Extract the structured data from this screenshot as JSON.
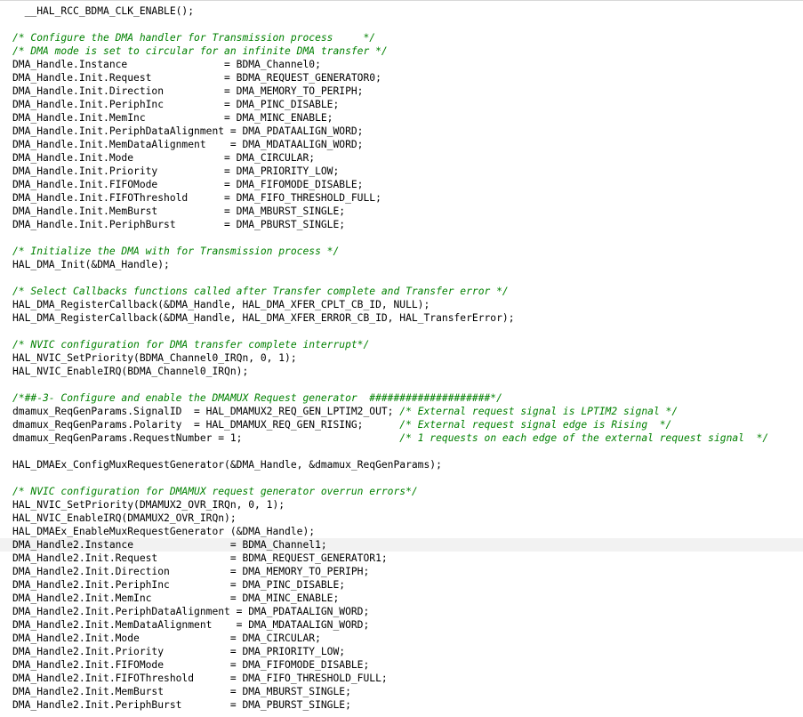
{
  "editor": {
    "current_line_index": 40,
    "colors": {
      "background": "#ffffff",
      "code": "#000000",
      "comment": "#008000",
      "current_line": "#f2f2f2"
    },
    "lines": [
      [
        {
          "t": "code",
          "s": "  __HAL_RCC_BDMA_CLK_ENABLE();"
        }
      ],
      [],
      [
        {
          "t": "comment",
          "s": "/* Configure the DMA handler for Transmission process     */"
        }
      ],
      [
        {
          "t": "comment",
          "s": "/* DMA mode is set to circular for an infinite DMA transfer */"
        }
      ],
      [
        {
          "t": "code",
          "s": "DMA_Handle.Instance                = BDMA_Channel0;"
        }
      ],
      [
        {
          "t": "code",
          "s": "DMA_Handle.Init.Request            = BDMA_REQUEST_GENERATOR0;"
        }
      ],
      [
        {
          "t": "code",
          "s": "DMA_Handle.Init.Direction          = DMA_MEMORY_TO_PERIPH;"
        }
      ],
      [
        {
          "t": "code",
          "s": "DMA_Handle.Init.PeriphInc          = DMA_PINC_DISABLE;"
        }
      ],
      [
        {
          "t": "code",
          "s": "DMA_Handle.Init.MemInc             = DMA_MINC_ENABLE;"
        }
      ],
      [
        {
          "t": "code",
          "s": "DMA_Handle.Init.PeriphDataAlignment = DMA_PDATAALIGN_WORD;"
        }
      ],
      [
        {
          "t": "code",
          "s": "DMA_Handle.Init.MemDataAlignment    = DMA_MDATAALIGN_WORD;"
        }
      ],
      [
        {
          "t": "code",
          "s": "DMA_Handle.Init.Mode               = DMA_CIRCULAR;"
        }
      ],
      [
        {
          "t": "code",
          "s": "DMA_Handle.Init.Priority           = DMA_PRIORITY_LOW;"
        }
      ],
      [
        {
          "t": "code",
          "s": "DMA_Handle.Init.FIFOMode           = DMA_FIFOMODE_DISABLE;"
        }
      ],
      [
        {
          "t": "code",
          "s": "DMA_Handle.Init.FIFOThreshold      = DMA_FIFO_THRESHOLD_FULL;"
        }
      ],
      [
        {
          "t": "code",
          "s": "DMA_Handle.Init.MemBurst           = DMA_MBURST_SINGLE;"
        }
      ],
      [
        {
          "t": "code",
          "s": "DMA_Handle.Init.PeriphBurst        = DMA_PBURST_SINGLE;"
        }
      ],
      [],
      [
        {
          "t": "comment",
          "s": "/* Initialize the DMA with for Transmission process */"
        }
      ],
      [
        {
          "t": "code",
          "s": "HAL_DMA_Init(&DMA_Handle);"
        }
      ],
      [],
      [
        {
          "t": "comment",
          "s": "/* Select Callbacks functions called after Transfer complete and Transfer error */"
        }
      ],
      [
        {
          "t": "code",
          "s": "HAL_DMA_RegisterCallback(&DMA_Handle, HAL_DMA_XFER_CPLT_CB_ID, NULL);"
        }
      ],
      [
        {
          "t": "code",
          "s": "HAL_DMA_RegisterCallback(&DMA_Handle, HAL_DMA_XFER_ERROR_CB_ID, HAL_TransferError);"
        }
      ],
      [],
      [
        {
          "t": "comment",
          "s": "/* NVIC configuration for DMA transfer complete interrupt*/"
        }
      ],
      [
        {
          "t": "code",
          "s": "HAL_NVIC_SetPriority(BDMA_Channel0_IRQn, 0, 1);"
        }
      ],
      [
        {
          "t": "code",
          "s": "HAL_NVIC_EnableIRQ(BDMA_Channel0_IRQn);"
        }
      ],
      [],
      [
        {
          "t": "comment",
          "s": "/*##-3- Configure and enable the DMAMUX Request generator  ####################*/"
        }
      ],
      [
        {
          "t": "code",
          "s": "dmamux_ReqGenParams.SignalID  = HAL_DMAMUX2_REQ_GEN_LPTIM2_OUT; "
        },
        {
          "t": "comment",
          "s": "/* External request signal is LPTIM2 signal */"
        }
      ],
      [
        {
          "t": "code",
          "s": "dmamux_ReqGenParams.Polarity  = HAL_DMAMUX_REQ_GEN_RISING;      "
        },
        {
          "t": "comment",
          "s": "/* External request signal edge is Rising  */"
        }
      ],
      [
        {
          "t": "code",
          "s": "dmamux_ReqGenParams.RequestNumber = 1;                          "
        },
        {
          "t": "comment",
          "s": "/* 1 requests on each edge of the external request signal  */"
        }
      ],
      [],
      [
        {
          "t": "code",
          "s": "HAL_DMAEx_ConfigMuxRequestGenerator(&DMA_Handle, &dmamux_ReqGenParams);"
        }
      ],
      [],
      [
        {
          "t": "comment",
          "s": "/* NVIC configuration for DMAMUX request generator overrun errors*/"
        }
      ],
      [
        {
          "t": "code",
          "s": "HAL_NVIC_SetPriority(DMAMUX2_OVR_IRQn, 0, 1);"
        }
      ],
      [
        {
          "t": "code",
          "s": "HAL_NVIC_EnableIRQ(DMAMUX2_OVR_IRQn);"
        }
      ],
      [
        {
          "t": "code",
          "s": "HAL_DMAEx_EnableMuxRequestGenerator (&DMA_Handle);"
        }
      ],
      [
        {
          "t": "code",
          "s": "DMA_Handle2.Instance                = BDMA_Channel1;"
        }
      ],
      [
        {
          "t": "code",
          "s": "DMA_Handle2.Init.Request            = BDMA_REQUEST_GENERATOR1;"
        }
      ],
      [
        {
          "t": "code",
          "s": "DMA_Handle2.Init.Direction          = DMA_MEMORY_TO_PERIPH;"
        }
      ],
      [
        {
          "t": "code",
          "s": "DMA_Handle2.Init.PeriphInc          = DMA_PINC_DISABLE;"
        }
      ],
      [
        {
          "t": "code",
          "s": "DMA_Handle2.Init.MemInc             = DMA_MINC_ENABLE;"
        }
      ],
      [
        {
          "t": "code",
          "s": "DMA_Handle2.Init.PeriphDataAlignment = DMA_PDATAALIGN_WORD;"
        }
      ],
      [
        {
          "t": "code",
          "s": "DMA_Handle2.Init.MemDataAlignment    = DMA_MDATAALIGN_WORD;"
        }
      ],
      [
        {
          "t": "code",
          "s": "DMA_Handle2.Init.Mode               = DMA_CIRCULAR;"
        }
      ],
      [
        {
          "t": "code",
          "s": "DMA_Handle2.Init.Priority           = DMA_PRIORITY_LOW;"
        }
      ],
      [
        {
          "t": "code",
          "s": "DMA_Handle2.Init.FIFOMode           = DMA_FIFOMODE_DISABLE;"
        }
      ],
      [
        {
          "t": "code",
          "s": "DMA_Handle2.Init.FIFOThreshold      = DMA_FIFO_THRESHOLD_FULL;"
        }
      ],
      [
        {
          "t": "code",
          "s": "DMA_Handle2.Init.MemBurst           = DMA_MBURST_SINGLE;"
        }
      ],
      [
        {
          "t": "code",
          "s": "DMA_Handle2.Init.PeriphBurst        = DMA_PBURST_SINGLE;"
        }
      ]
    ]
  }
}
